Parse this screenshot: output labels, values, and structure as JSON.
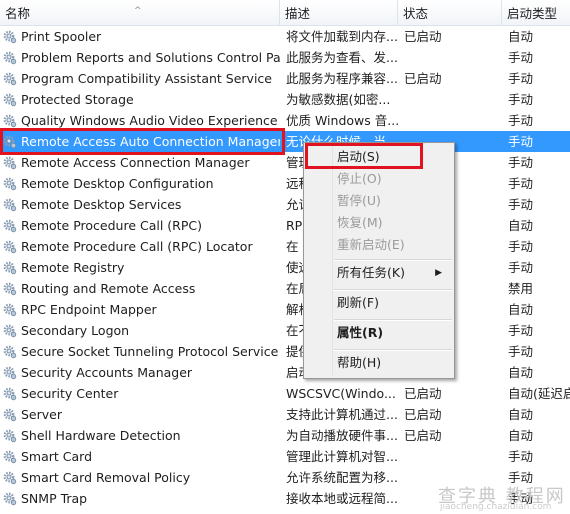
{
  "columns": [
    "名称",
    "描述",
    "状态",
    "启动类型"
  ],
  "rows": [
    [
      "Print Spooler",
      "将文件加载到内存...",
      "已启动",
      "自动"
    ],
    [
      "Problem Reports and Solutions Control Pa...",
      "此服务为查看、发...",
      "",
      "手动"
    ],
    [
      "Program Compatibility Assistant Service",
      "此服务为程序兼容...",
      "已启动",
      "手动"
    ],
    [
      "Protected Storage",
      "为敏感数据(如密...",
      "",
      "手动"
    ],
    [
      "Quality Windows Audio Video Experience",
      "优质 Windows 音...",
      "",
      "手动"
    ],
    [
      "Remote Access Auto Connection Manager",
      "无论什么时候，当...",
      "",
      "手动"
    ],
    [
      "Remote Access Connection Manager",
      "管理",
      "",
      "手动"
    ],
    [
      "Remote Desktop Configuration",
      "远程",
      "",
      "手动"
    ],
    [
      "Remote Desktop Services",
      "允许",
      "",
      "手动"
    ],
    [
      "Remote Procedure Call (RPC)",
      "RPC",
      "",
      "自动"
    ],
    [
      "Remote Procedure Call (RPC) Locator",
      "在",
      "",
      "手动"
    ],
    [
      "Remote Registry",
      "使远",
      "",
      "手动"
    ],
    [
      "Routing and Remote Access",
      "在局",
      "",
      "禁用"
    ],
    [
      "RPC Endpoint Mapper",
      "解析",
      "",
      "自动"
    ],
    [
      "Secondary Logon",
      "在不",
      "",
      "手动"
    ],
    [
      "Secure Socket Tunneling Protocol Service",
      "提供",
      "",
      "手动"
    ],
    [
      "Security Accounts Manager",
      "启动",
      "",
      "自动"
    ],
    [
      "Security Center",
      "WSCSVC(Windo...",
      "已启动",
      "自动(延迟启"
    ],
    [
      "Server",
      "支持此计算机通过...",
      "已启动",
      "自动"
    ],
    [
      "Shell Hardware Detection",
      "为自动播放硬件事...",
      "已启动",
      "自动"
    ],
    [
      "Smart Card",
      "管理此计算机对智...",
      "",
      "手动"
    ],
    [
      "Smart Card Removal Policy",
      "允许系统配置为移...",
      "",
      "手动"
    ],
    [
      "SNMP Trap",
      "接收本地或远程简...",
      "",
      "手动"
    ]
  ],
  "selected_index": 5,
  "menu": [
    {
      "label": "启动(S)",
      "state": "enabled"
    },
    {
      "label": "停止(O)",
      "state": "disabled"
    },
    {
      "label": "暂停(U)",
      "state": "disabled"
    },
    {
      "label": "恢复(M)",
      "state": "disabled"
    },
    {
      "label": "重新启动(E)",
      "state": "disabled"
    },
    {
      "label": "所有任务(K)",
      "state": "submenu"
    },
    {
      "label": "刷新(F)",
      "state": "enabled"
    },
    {
      "label": "属性(R)",
      "state": "bold"
    },
    {
      "label": "帮助(H)",
      "state": "enabled"
    }
  ],
  "watermark": "查字典 教程网",
  "watermark_url": "jiaocheng.chazidian.com",
  "colors": {
    "selection": "#3399ff",
    "highlight_box": "#e0141e"
  }
}
